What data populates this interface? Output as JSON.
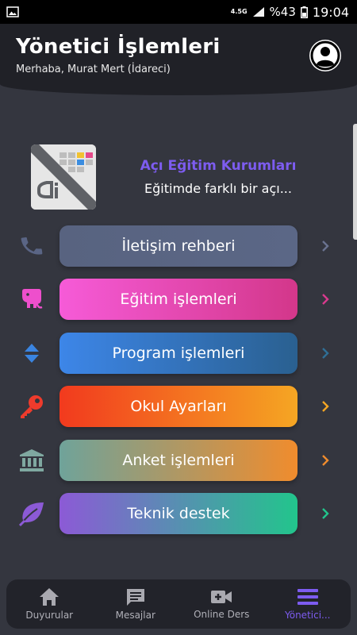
{
  "status_bar": {
    "network": "4.5G",
    "battery": "%43",
    "time": "19:04"
  },
  "header": {
    "title": "Yönetici İşlemleri",
    "subtitle": "Merhaba, Murat Mert (İdareci)"
  },
  "institution": {
    "name": "Açı Eğitim Kurumları",
    "slogan": "Eğitimde farklı bir açı..."
  },
  "menu": [
    {
      "label": "İletişim rehberi",
      "icon": "phone-icon",
      "icon_color": "#5a6585",
      "gradient": [
        "#586380",
        "#5b6786"
      ],
      "chevron_color": "#6a7390"
    },
    {
      "label": "Eğitim işlemleri",
      "icon": "elephant-icon",
      "icon_color": "#ee4fcc",
      "gradient": [
        "#f65bd8",
        "#d3378a"
      ],
      "chevron_color": "#d93a8e"
    },
    {
      "label": "Program işlemleri",
      "icon": "sort-arrows-icon",
      "icon_color": "#3a84e0",
      "gradient": [
        "#3d86e8",
        "#2a6090"
      ],
      "chevron_color": "#2f6f96"
    },
    {
      "label": "Okul Ayarları",
      "icon": "key-icon",
      "icon_color": "#ee3b2c",
      "gradient": [
        "#f23a1e",
        "#f5a623"
      ],
      "chevron_color": "#f5a623"
    },
    {
      "label": "Anket işlemleri",
      "icon": "bank-icon",
      "icon_color": "#7fa8a0",
      "gradient": [
        "#6fa39a",
        "#f08c2d"
      ],
      "chevron_color": "#f08c2d"
    },
    {
      "label": "Teknik destek",
      "icon": "leaf-icon",
      "icon_color": "#8c5ad6",
      "gradient": [
        "#8c5ad6",
        "#22c58c"
      ],
      "chevron_color": "#22c58c"
    }
  ],
  "bottom_nav": [
    {
      "label": "Duyurular",
      "icon": "home-icon",
      "active": false
    },
    {
      "label": "Mesajlar",
      "icon": "message-icon",
      "active": false
    },
    {
      "label": "Online Ders",
      "icon": "video-camera-icon",
      "active": false
    },
    {
      "label": "Yönetici...",
      "icon": "menu-icon",
      "active": true
    }
  ],
  "colors": {
    "accent": "#7d5cf0",
    "background": "#34363f",
    "header": "#202127"
  }
}
